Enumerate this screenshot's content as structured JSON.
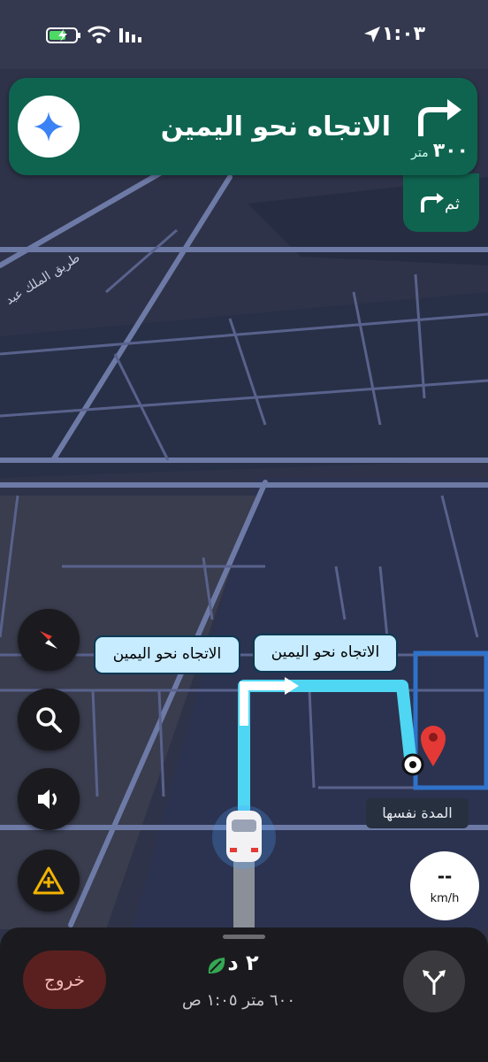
{
  "status_bar": {
    "time": "١:٠٣"
  },
  "navigation": {
    "instruction": "الاتجاه نحو اليمين",
    "distance_value": "٣٠٠",
    "distance_unit": "متر",
    "then_label": "ثم"
  },
  "map": {
    "road_label": "طريق الملك عبد",
    "route_callouts": [
      "الاتجاه نحو اليمين",
      "الاتجاه نحو اليمين"
    ],
    "route_chip": "المدة نفسها"
  },
  "speed": {
    "value": "--",
    "unit": "km/h"
  },
  "bottom_panel": {
    "exit_label": "خروج",
    "eta_duration": "٢ د",
    "eta_details": "٦٠٠ متر ١:٠٥ ص"
  },
  "colors": {
    "map_background": "#2e3349",
    "nav_card": "#0f6450",
    "route": "#4fd6f2",
    "destination_pin": "#e53935"
  },
  "icons": [
    "turn-right-icon",
    "gemini-icon",
    "compass-icon",
    "search-icon",
    "volume-icon",
    "report-incident-icon",
    "eco-leaf-icon",
    "alternate-routes-icon",
    "destination-pin-icon",
    "car-icon"
  ]
}
